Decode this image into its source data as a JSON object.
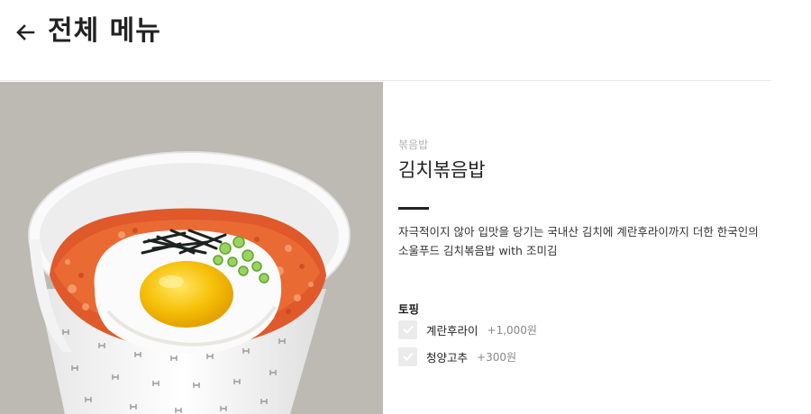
{
  "header": {
    "title": "전체 메뉴",
    "back_icon": "arrow-left-icon"
  },
  "product": {
    "category": "볶음밥",
    "name": "김치볶음밥",
    "description_line1": "자극적이지 않아 입맛을 당기는 국내산 김치에 계란후라이까지 더한 한국인의",
    "description_line2": "소울푸드 김치볶음밥 with 조미김",
    "image": "kimchi-fried-rice-cup-photo"
  },
  "toppings": {
    "title": "토핑",
    "options": [
      {
        "name": "계란후라이",
        "price": "+1,000원",
        "checked": false
      },
      {
        "name": "청양고추",
        "price": "+300원",
        "checked": false
      }
    ]
  },
  "colors": {
    "photo_background": "#bdb9b3",
    "checkbox_bg": "#ebebeb",
    "divider": "#222222"
  }
}
